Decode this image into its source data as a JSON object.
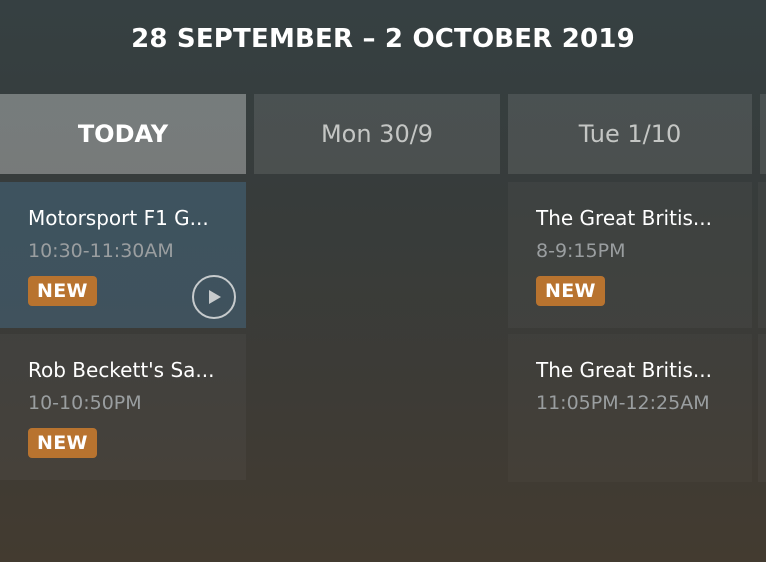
{
  "header": {
    "title": "28 SEPTEMBER – 2 OCTOBER 2019"
  },
  "tabs": [
    {
      "label": "TODAY",
      "selected": true
    },
    {
      "label": "Mon 30/9",
      "selected": false
    },
    {
      "label": "Tue 1/10",
      "selected": false
    }
  ],
  "programs": [
    {
      "title": "Motorsport F1 G...",
      "time": "10:30-11:30AM",
      "badge": "NEW",
      "icon": "play-icon"
    },
    {
      "title": "Rob Beckett's Sa...",
      "time": "10-10:50PM",
      "badge": "NEW"
    },
    {
      "title": "The Great Britis...",
      "time": "8-9:15PM",
      "badge": "NEW"
    },
    {
      "title": "The Great Britis...",
      "time": "11:05PM-12:25AM"
    }
  ],
  "colors": {
    "badge": "#b8732f",
    "selected_tab": "#8a8e8d",
    "highlighted_card": "#3a4a55"
  }
}
